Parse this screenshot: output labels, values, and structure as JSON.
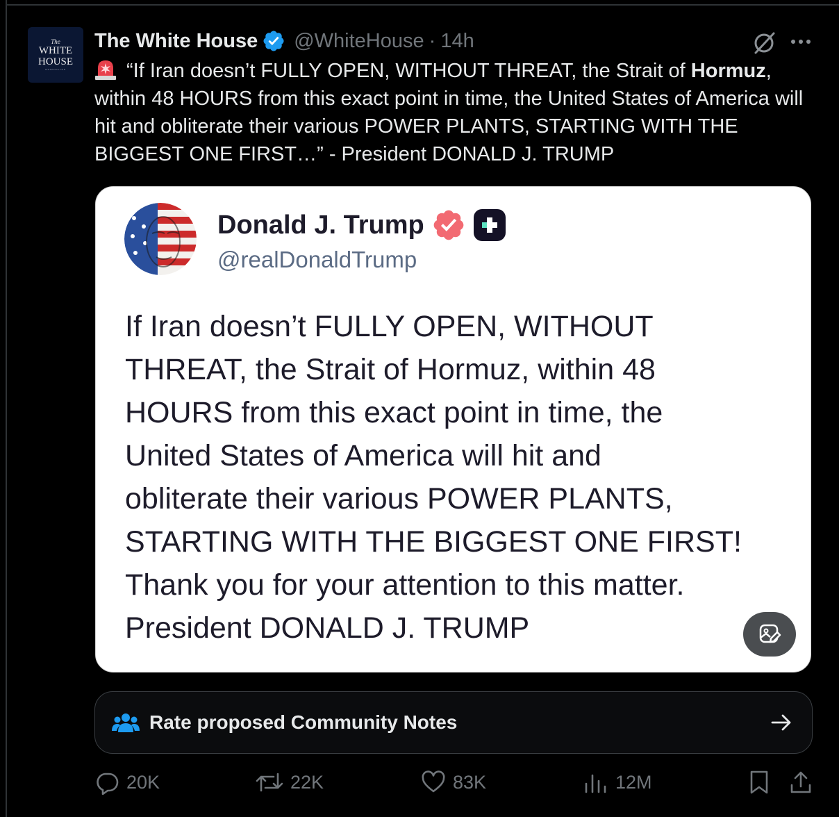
{
  "post": {
    "author_name": "The White House",
    "author_handle": "@WhiteHouse",
    "separator": "·",
    "time": "14h",
    "avatar": {
      "line1": "The",
      "line2": "WHITE",
      "line3": "HOUSE",
      "line4": "WASHINGTON"
    },
    "text_part1": "“If Iran doesn’t FULLY OPEN, WITHOUT THREAT, the Strait of ",
    "text_bold": "Hormuz",
    "text_part2": ", within 48 HOURS from this exact point in time, the United States of America will hit and obliterate their various POWER PLANTS, STARTING WITH THE BIGGEST ONE FIRST…” - President DONALD J. TRUMP"
  },
  "quoted": {
    "author_name": "Donald J. Trump",
    "author_handle": "@realDonaldTrump",
    "body": "If Iran doesn’t FULLY OPEN, WITHOUT\nTHREAT, the Strait of Hormuz, within 48\nHOURS from this exact point in time, the\nUnited States of America will hit and\nobliterate their various POWER PLANTS,\nSTARTING WITH THE BIGGEST ONE FIRST!\nThank you for your attention to this matter.\nPresident DONALD J. TRUMP"
  },
  "community_notes": {
    "label": "Rate proposed Community Notes"
  },
  "actions": {
    "replies": "20K",
    "reposts": "22K",
    "likes": "83K",
    "views": "12M"
  },
  "icons": {
    "verified": "verified-badge-icon",
    "grok": "grok-icon",
    "more": "more-icon",
    "siren": "siren-emoji-icon",
    "truth_social": "truth-social-icon",
    "edit_image": "edit-image-icon",
    "community": "community-notes-icon",
    "arrow": "arrow-right-icon",
    "reply": "reply-icon",
    "repost": "repost-icon",
    "like": "like-icon",
    "views": "views-icon",
    "bookmark": "bookmark-icon",
    "share": "share-icon"
  },
  "colors": {
    "background": "#000000",
    "text": "#e7e9ea",
    "muted": "#71767b",
    "verified_blue": "#1d9bf0",
    "truth_verified": "#f26a72",
    "community_blue": "#1d9bf0"
  }
}
